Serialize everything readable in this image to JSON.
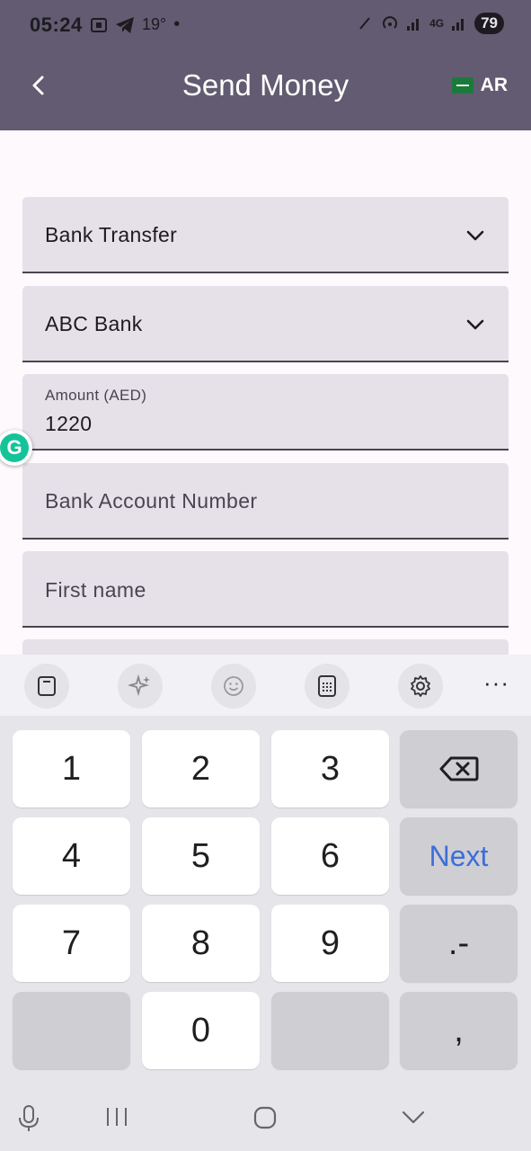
{
  "status_bar": {
    "time": "05:24",
    "temperature": "19°",
    "network": "4G",
    "battery": "79"
  },
  "app_bar": {
    "title": "Send Money",
    "language": "AR"
  },
  "form": {
    "transfer_type": "Bank Transfer",
    "bank": "ABC Bank",
    "amount_label": "Amount (AED)",
    "amount_value": "1220",
    "account_number_placeholder": "Bank Account Number",
    "first_name_placeholder": "First name"
  },
  "keyboard": {
    "tools": [
      "clipboard-icon",
      "sparkle-icon",
      "emoji-icon",
      "keypad-icon",
      "settings-icon",
      "more-icon"
    ],
    "more_label": "···",
    "keys": {
      "k1": "1",
      "k2": "2",
      "k3": "3",
      "k4": "4",
      "k5": "5",
      "k6": "6",
      "k7": "7",
      "k8": "8",
      "k9": "9",
      "k0": "0",
      "next": "Next",
      "dot_dash": ".-",
      "comma": ","
    }
  },
  "colors": {
    "app_bar": "#625b71",
    "field_bg": "#e6e0e9",
    "accent_next": "#3b6ed9"
  }
}
